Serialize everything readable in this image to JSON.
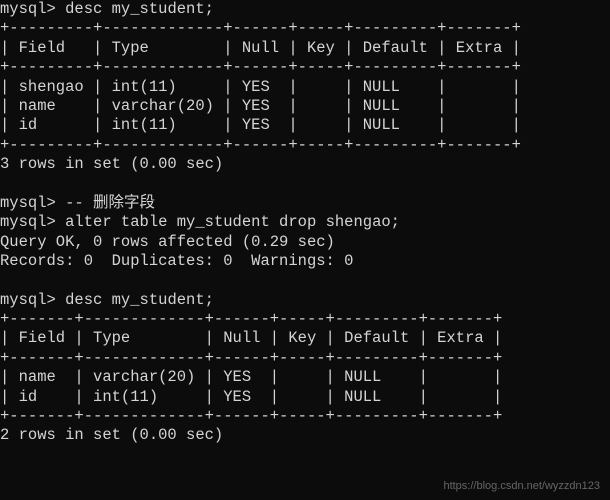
{
  "prompt": "mysql>",
  "cmd1": "desc my_student;",
  "table1": {
    "border_top": "+---------+-------------+------+-----+---------+-------+",
    "header": "| Field   | Type        | Null | Key | Default | Extra |",
    "border_mid": "+---------+-------------+------+-----+---------+-------+",
    "rows": [
      "| shengao | int(11)     | YES  |     | NULL    |       |",
      "| name    | varchar(20) | YES  |     | NULL    |       |",
      "| id      | int(11)     | YES  |     | NULL    |       |"
    ],
    "border_bot": "+---------+-------------+------+-----+---------+-------+"
  },
  "result1": "3 rows in set (0.00 sec)",
  "comment_cmd": "-- 删除字段",
  "cmd2": "alter table my_student drop shengao;",
  "result2a": "Query OK, 0 rows affected (0.29 sec)",
  "result2b": "Records: 0  Duplicates: 0  Warnings: 0",
  "cmd3": "desc my_student;",
  "table2": {
    "border_top": "+-------+-------------+------+-----+---------+-------+",
    "header": "| Field | Type        | Null | Key | Default | Extra |",
    "border_mid": "+-------+-------------+------+-----+---------+-------+",
    "rows": [
      "| name  | varchar(20) | YES  |     | NULL    |       |",
      "| id    | int(11)     | YES  |     | NULL    |       |"
    ],
    "border_bot": "+-------+-------------+------+-----+---------+-------+"
  },
  "result3": "2 rows in set (0.00 sec)",
  "watermark": "https://blog.csdn.net/wyzzdn123"
}
